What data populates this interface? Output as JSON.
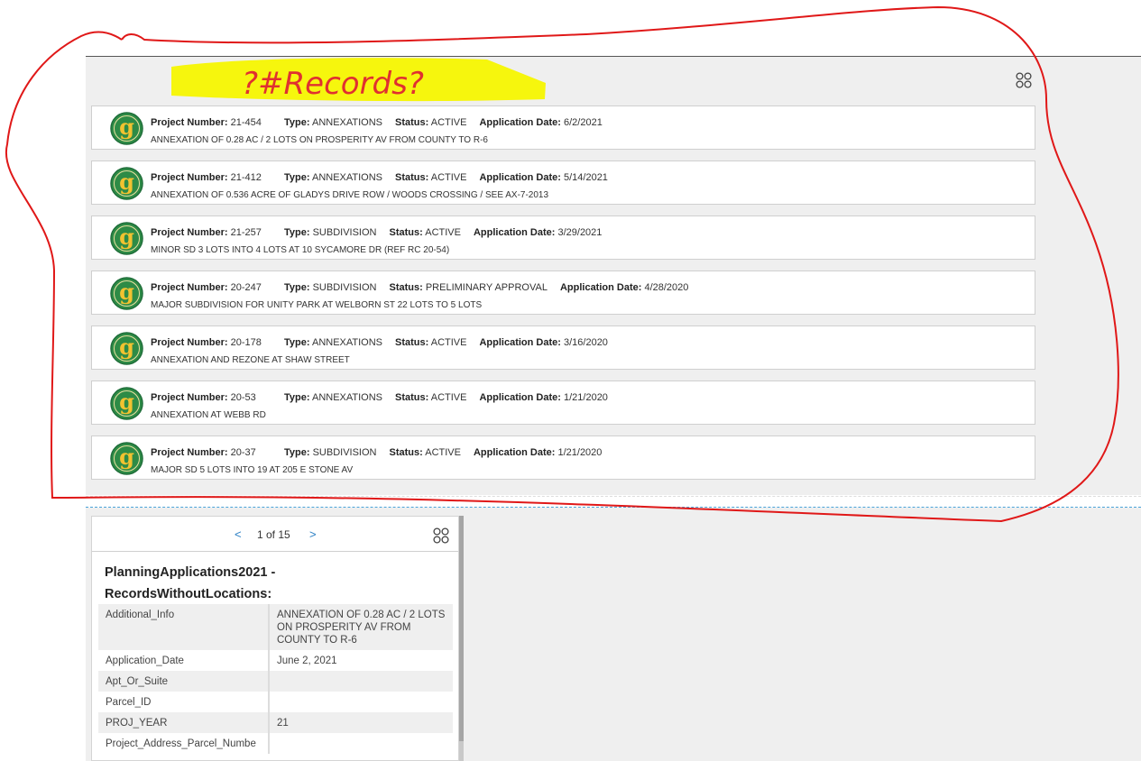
{
  "annotation": {
    "note_text": "?#Records?",
    "highlight_color": "#f5f500",
    "ink_color": "#e03030"
  },
  "field_labels": {
    "project_number": "Project Number:",
    "type": "Type:",
    "status": "Status:",
    "application_date": "Application Date:"
  },
  "records": [
    {
      "project_number": "21-454",
      "type": "ANNEXATIONS",
      "status": "ACTIVE",
      "application_date": "6/2/2021",
      "description": "ANNEXATION OF 0.28 AC / 2 LOTS ON PROSPERITY AV FROM COUNTY TO R-6"
    },
    {
      "project_number": "21-412",
      "type": "ANNEXATIONS",
      "status": "ACTIVE",
      "application_date": "5/14/2021",
      "description": "ANNEXATION OF 0.536 ACRE OF GLADYS DRIVE ROW / WOODS CROSSING / SEE AX-7-2013"
    },
    {
      "project_number": "21-257",
      "type": "SUBDIVISION",
      "status": "ACTIVE",
      "application_date": "3/29/2021",
      "description": "MINOR SD 3 LOTS INTO 4 LOTS AT 10 SYCAMORE DR (REF RC 20-54)"
    },
    {
      "project_number": "20-247",
      "type": "SUBDIVISION",
      "status": "PRELIMINARY APPROVAL",
      "application_date": "4/28/2020",
      "description": "MAJOR SUBDIVISION FOR UNITY PARK AT WELBORN ST 22 LOTS TO 5 LOTS"
    },
    {
      "project_number": "20-178",
      "type": "ANNEXATIONS",
      "status": "ACTIVE",
      "application_date": "3/16/2020",
      "description": "ANNEXATION AND REZONE  AT SHAW STREET"
    },
    {
      "project_number": "20-53",
      "type": "ANNEXATIONS",
      "status": "ACTIVE",
      "application_date": "1/21/2020",
      "description": "ANNEXATION AT WEBB RD"
    },
    {
      "project_number": "20-37",
      "type": "SUBDIVISION",
      "status": "ACTIVE",
      "application_date": "1/21/2020",
      "description": "MAJOR SD 5 LOTS INTO 19 AT 205 E STONE AV"
    }
  ],
  "logo": {
    "letter": "g",
    "ring_color": "#1f6e3a",
    "fill_color": "#2e8b46",
    "letter_color": "#f2c230"
  },
  "popup": {
    "pager": {
      "prev": "<",
      "text": "1 of 15",
      "next": ">"
    },
    "title_line1": "PlanningApplications2021 -",
    "title_line2": "RecordsWithoutLocations:",
    "rows": [
      {
        "key": "Additional_Info",
        "value": "ANNEXATION OF 0.28 AC / 2 LOTS ON PROSPERITY AV FROM COUNTY TO R-6"
      },
      {
        "key": "Application_Date",
        "value": "June 2, 2021"
      },
      {
        "key": "Apt_Or_Suite",
        "value": ""
      },
      {
        "key": "Parcel_ID",
        "value": ""
      },
      {
        "key": "PROJ_YEAR",
        "value": "21"
      },
      {
        "key": "Project_Address_Parcel_Numbe",
        "value": ""
      }
    ]
  },
  "colors": {
    "link_blue": "#2a7fc4",
    "panel_gray": "#efefef"
  }
}
